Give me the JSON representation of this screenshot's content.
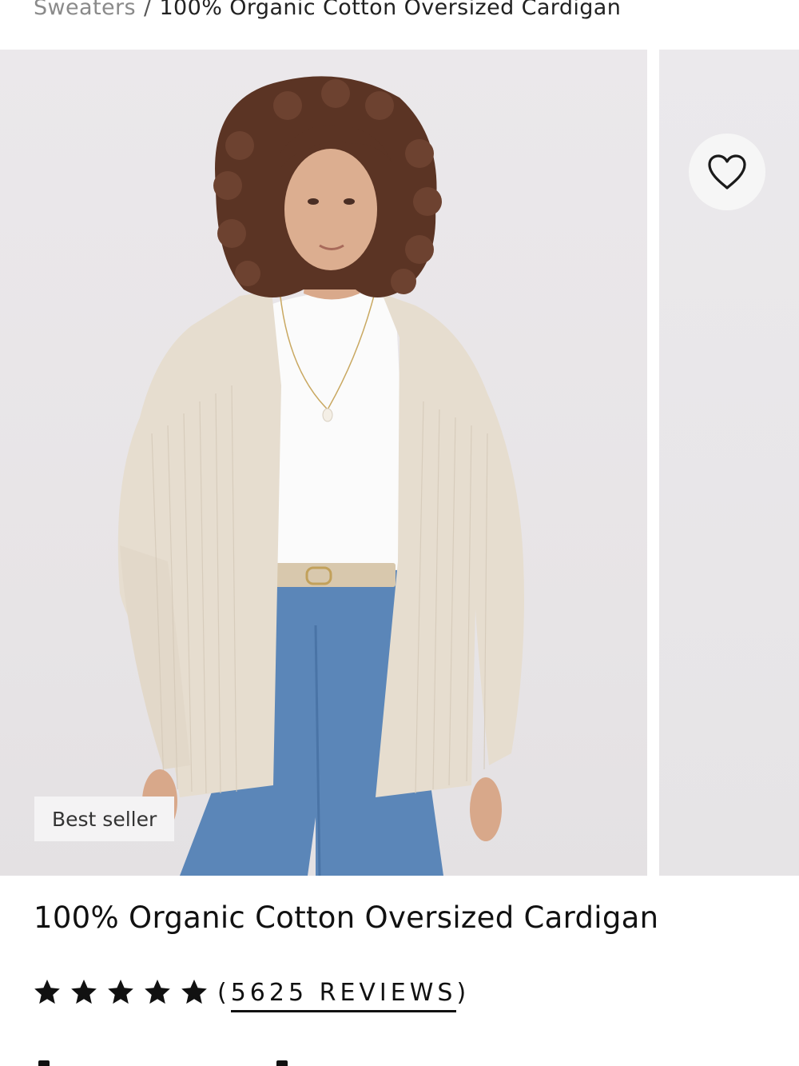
{
  "breadcrumb": {
    "parent": "Sweaters",
    "separator": "/",
    "current": "100% Organic Cotton Oversized Cardigan"
  },
  "gallery": {
    "badge": "Best seller",
    "wishlist_icon": "heart-outline-icon"
  },
  "product": {
    "title": "100% Organic Cotton Oversized Cardigan",
    "rating": {
      "stars": 5,
      "max": 5,
      "open_paren": "(",
      "reviews_label": "5625 REVIEWS",
      "close_paren": ")"
    }
  },
  "colors": {
    "background": "#ffffff",
    "text": "#111111",
    "muted": "#8a8a8a",
    "photo_backdrop": "#e9e6e9",
    "cardigan": "#e6ddcf",
    "denim": "#5b86b8"
  }
}
